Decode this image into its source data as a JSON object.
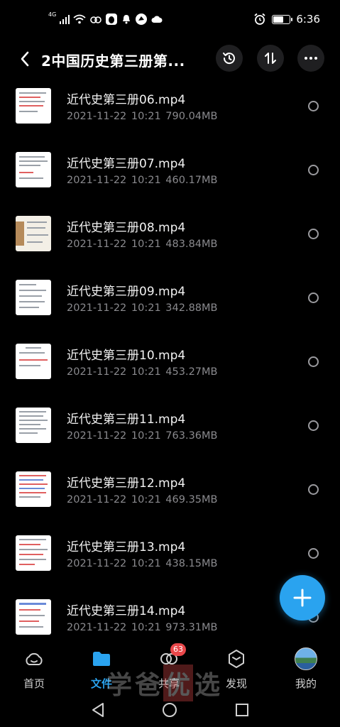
{
  "status_bar": {
    "network": "4G",
    "time": "6:36",
    "icons": [
      "signal-icon",
      "wifi-icon",
      "baidu-netdisk-icon",
      "qq-icon",
      "feishu-icon",
      "cloud-icon",
      "alarm-icon",
      "battery-icon"
    ]
  },
  "header": {
    "title": "2中国历史第三册第...",
    "actions": [
      "history-icon",
      "sort-icon",
      "more-icon"
    ]
  },
  "files": [
    {
      "name": "近代史第三册06.mp4",
      "date": "2021-11-22",
      "time": "10:21",
      "size": "790.04MB"
    },
    {
      "name": "近代史第三册07.mp4",
      "date": "2021-11-22",
      "time": "10:21",
      "size": "460.17MB"
    },
    {
      "name": "近代史第三册08.mp4",
      "date": "2021-11-22",
      "time": "10:21",
      "size": "483.84MB"
    },
    {
      "name": "近代史第三册09.mp4",
      "date": "2021-11-22",
      "time": "10:21",
      "size": "342.88MB"
    },
    {
      "name": "近代史第三册10.mp4",
      "date": "2021-11-22",
      "time": "10:21",
      "size": "453.27MB"
    },
    {
      "name": "近代史第三册11.mp4",
      "date": "2021-11-22",
      "time": "10:21",
      "size": "763.36MB"
    },
    {
      "name": "近代史第三册12.mp4",
      "date": "2021-11-22",
      "time": "10:21",
      "size": "469.35MB"
    },
    {
      "name": "近代史第三册13.mp4",
      "date": "2021-11-22",
      "time": "10:21",
      "size": "438.15MB"
    },
    {
      "name": "近代史第三册14.mp4",
      "date": "2021-11-22",
      "time": "10:21",
      "size": "973.31MB"
    }
  ],
  "fab": {
    "icon": "plus-icon"
  },
  "bottom_nav": {
    "home": {
      "label": "首页",
      "icon": "cloud-outline-icon"
    },
    "files": {
      "label": "文件",
      "icon": "folder-icon"
    },
    "share": {
      "label": "共享",
      "icon": "share-icon",
      "badge": "63"
    },
    "discover": {
      "label": "发现",
      "icon": "discover-icon"
    },
    "mine": {
      "label": "我的",
      "icon": "avatar"
    }
  },
  "watermark": {
    "chars": [
      "学",
      "爸",
      "优",
      "选"
    ]
  },
  "colors": {
    "accent": "#2aa3ef",
    "badge": "#e8474a",
    "background": "#000000",
    "meta_text": "#8a8a8e"
  }
}
